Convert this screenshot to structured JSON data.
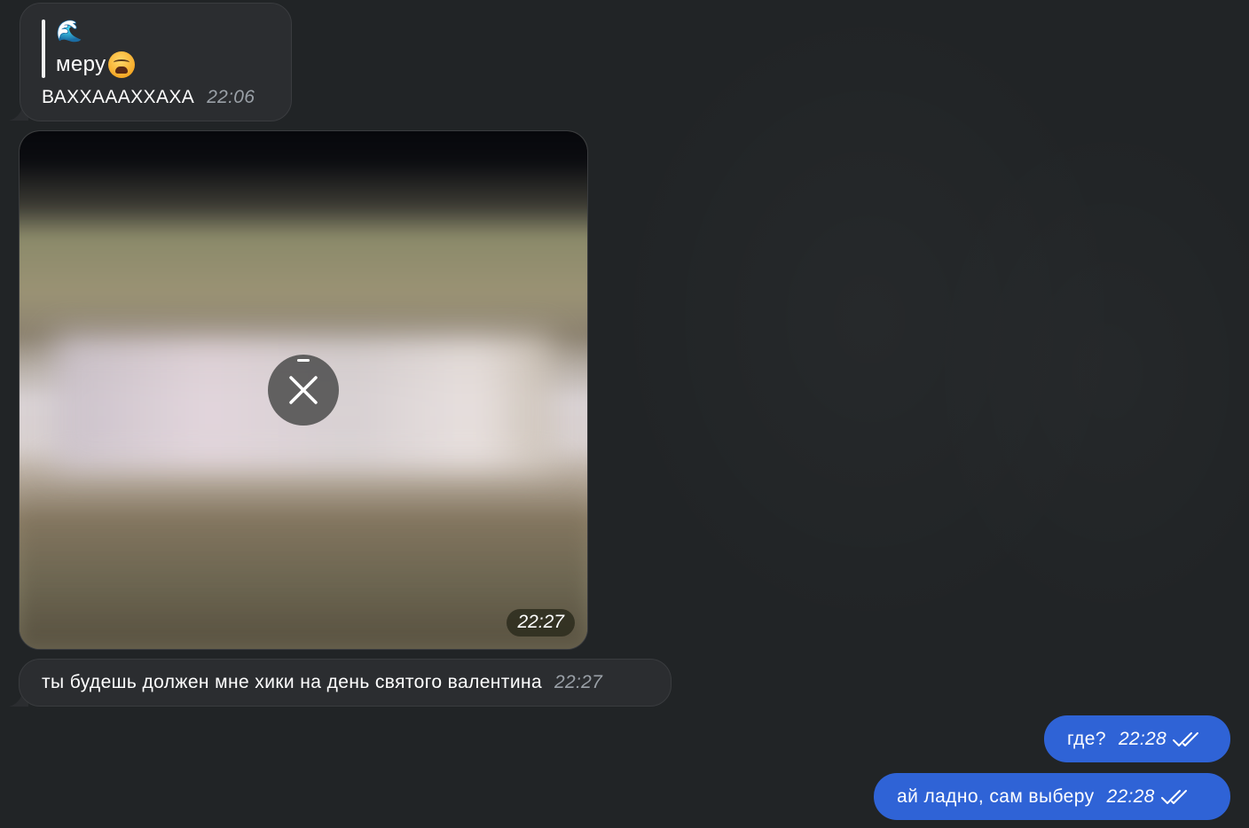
{
  "messages": [
    {
      "direction": "incoming",
      "quote": {
        "emoji": "🌊",
        "text": "меру"
      },
      "text": "ВАХХАААХХАХА",
      "time": "22:06"
    },
    {
      "direction": "incoming",
      "type": "photo",
      "state": "loading",
      "time": "22:27"
    },
    {
      "direction": "incoming",
      "text": "ты будешь должен мне хики на день святого валентина",
      "time": "22:27"
    },
    {
      "direction": "outgoing",
      "text": "где?",
      "time": "22:28",
      "status": "read"
    },
    {
      "direction": "outgoing",
      "text": "ай ладно, сам выберу",
      "time": "22:28",
      "status": "read"
    }
  ],
  "colors": {
    "background": "#212426",
    "incoming_bubble": "#2b2d30",
    "outgoing_bubble": "#2f63d6",
    "timestamp": "#9aa0a7"
  },
  "icons": [
    "wave-emoji",
    "weary-face-emoji",
    "close-icon",
    "double-check-icon"
  ]
}
